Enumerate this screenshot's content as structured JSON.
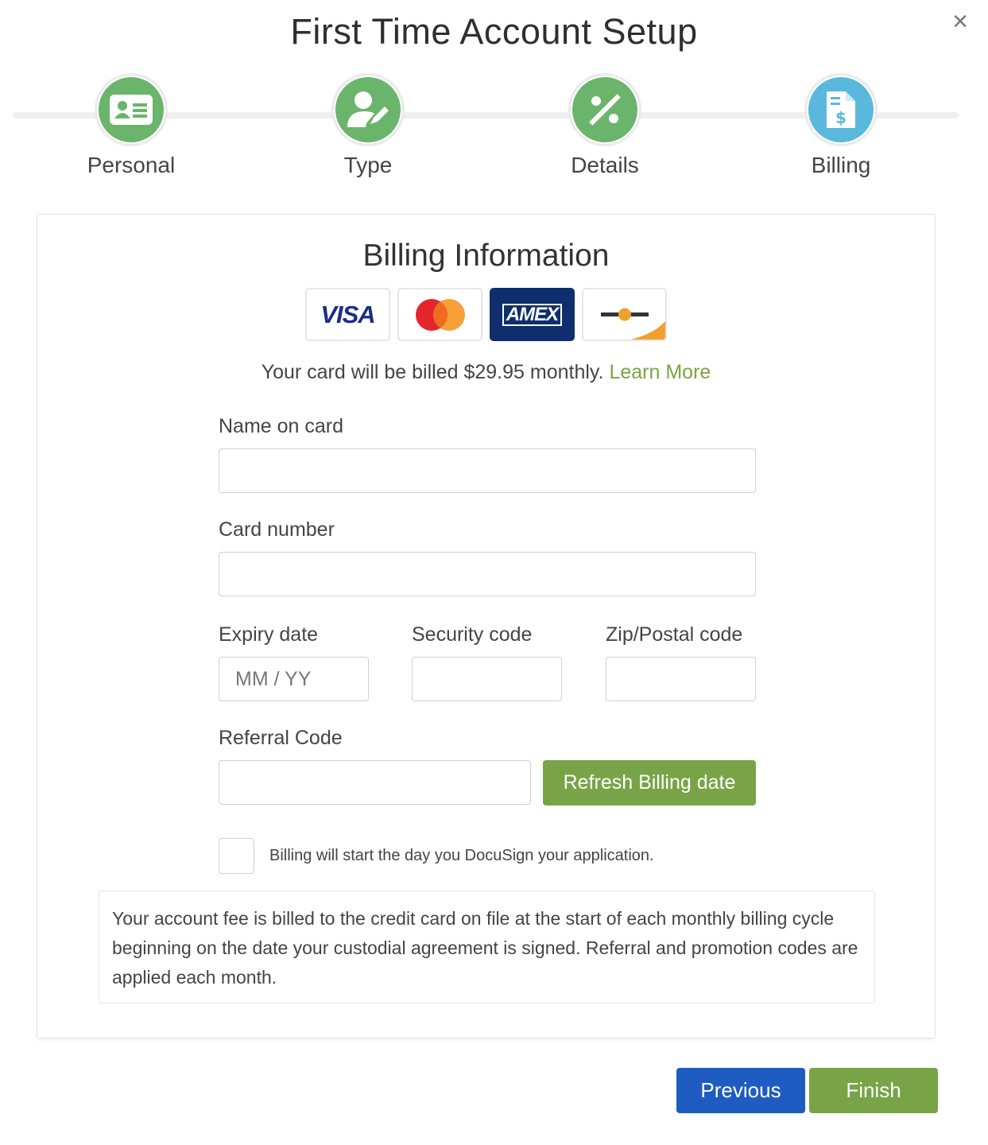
{
  "dialog": {
    "title": "First Time Account Setup",
    "close_icon": "close-icon"
  },
  "steps": [
    {
      "label": "Personal",
      "icon": "id-card-icon",
      "color": "#6ab56b"
    },
    {
      "label": "Type",
      "icon": "user-edit-icon",
      "color": "#6ab56b"
    },
    {
      "label": "Details",
      "icon": "percent-icon",
      "color": "#6ab56b"
    },
    {
      "label": "Billing",
      "icon": "invoice-dollar-icon",
      "color": "#5ab8dd"
    }
  ],
  "billing": {
    "title": "Billing Information",
    "card_brands": [
      {
        "name": "visa",
        "label": "VISA"
      },
      {
        "name": "mastercard"
      },
      {
        "name": "amex",
        "label": "AMEX"
      },
      {
        "name": "discover"
      }
    ],
    "note": "Your card will be billed $29.95 monthly.",
    "learn_more": "Learn More",
    "fields": {
      "name_on_card": {
        "label": "Name on card",
        "value": ""
      },
      "card_number": {
        "label": "Card number",
        "value": ""
      },
      "expiry_date": {
        "label": "Expiry date",
        "placeholder": "MM / YY"
      },
      "security_code": {
        "label": "Security code",
        "value": ""
      },
      "zip_code": {
        "label": "Zip/Postal code",
        "value": ""
      },
      "referral_code": {
        "label": "Referral Code",
        "value": ""
      }
    },
    "refresh_button": "Refresh Billing date",
    "checkbox_label": "Billing will start the day you DocuSign your application.",
    "info_text": "Your account fee is billed to the credit card on file at the start of each monthly billing cycle beginning on the date your custodial agreement is signed. Referral and promotion codes are applied each month."
  },
  "footer": {
    "previous": "Previous",
    "finish": "Finish"
  },
  "colors": {
    "green_accent": "#78a447",
    "blue_primary": "#1f5cc1",
    "step_green": "#6ab56b",
    "step_blue": "#5ab8dd"
  }
}
